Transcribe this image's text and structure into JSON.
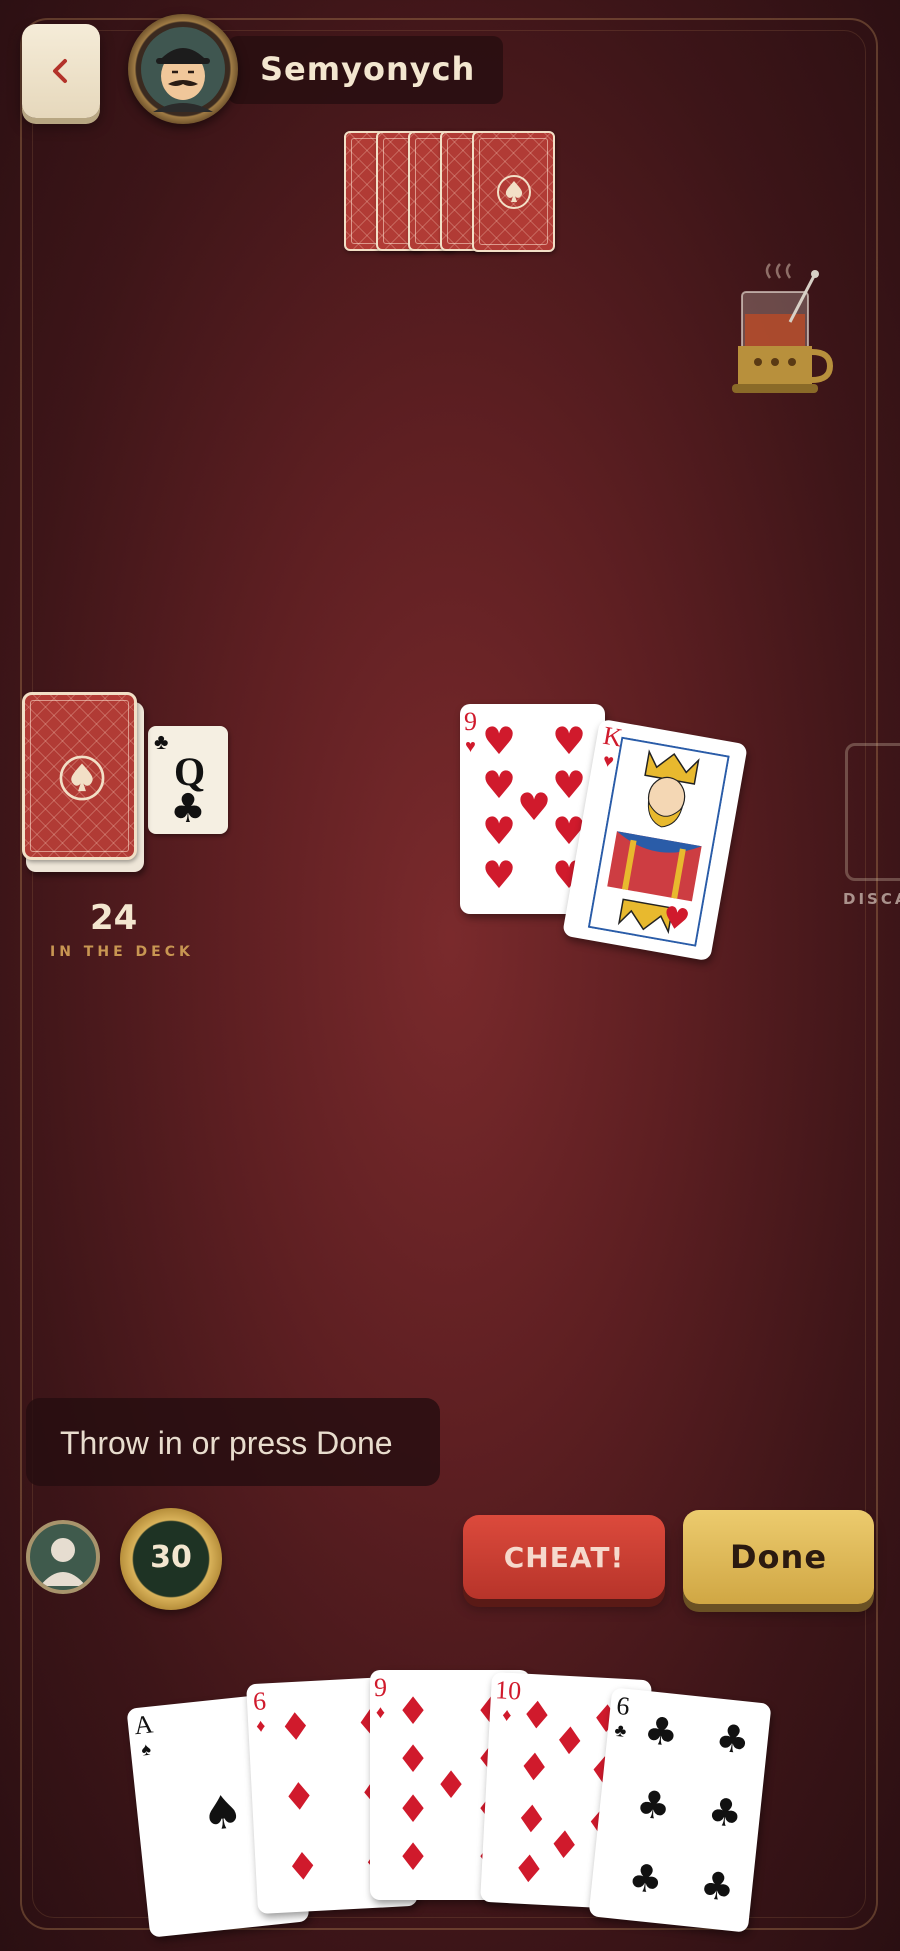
{
  "opponent": {
    "name": "Semyonych",
    "avatar_icon": "mustached-man-avatar-icon",
    "cards_in_hand": 5
  },
  "deck": {
    "count": "24",
    "label": "IN THE DECK",
    "trump": {
      "rank": "Q",
      "suit": "♣"
    }
  },
  "discard": {
    "label": "DISCA"
  },
  "table": {
    "cards": [
      {
        "rank": "9",
        "suit": "♥",
        "color": "red"
      },
      {
        "rank": "K",
        "suit": "♥",
        "color": "red"
      }
    ]
  },
  "prompt": {
    "text": "Throw in or press Done"
  },
  "player": {
    "chips": "30",
    "avatar_icon": "user-avatar-icon"
  },
  "buttons": {
    "cheat": "CHEAT!",
    "done": "Done"
  },
  "hand": [
    {
      "rank": "A",
      "suit": "♠"
    },
    {
      "rank": "6",
      "suit": "♦"
    },
    {
      "rank": "9",
      "suit": "♦"
    },
    {
      "rank": "10",
      "suit": "♦"
    },
    {
      "rank": "6",
      "suit": "♣"
    }
  ],
  "colors": {
    "felt": "#5e1f22",
    "cheat": "#c93b30",
    "done": "#dfb658",
    "red_suit": "#d01a2c"
  }
}
